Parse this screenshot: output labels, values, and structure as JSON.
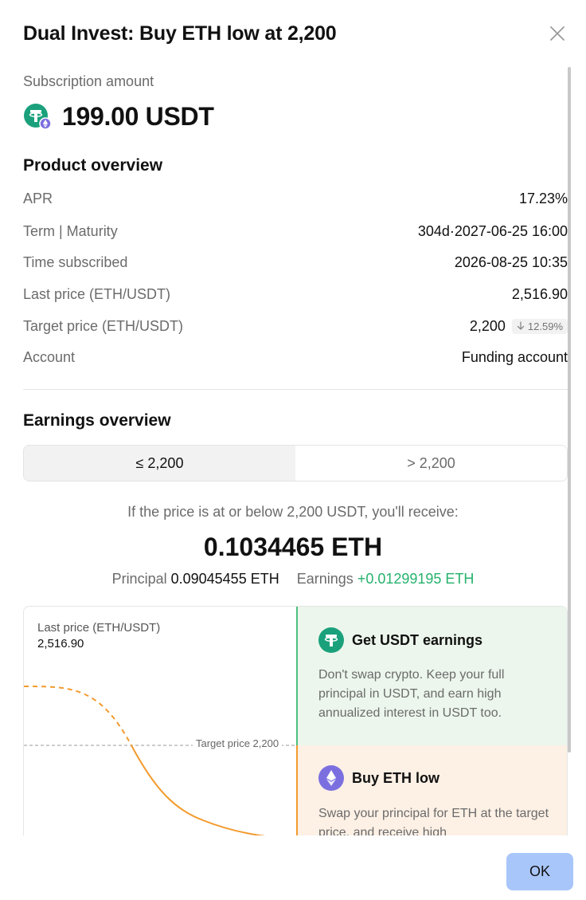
{
  "header": {
    "title": "Dual Invest: Buy ETH low at 2,200"
  },
  "subscription": {
    "label": "Subscription amount",
    "amount": "199.00 USDT",
    "coin_icon": "tether-icon"
  },
  "product_overview": {
    "title": "Product overview",
    "rows": [
      {
        "label": "APR",
        "value": "17.23%"
      },
      {
        "label": "Term | Maturity",
        "value": "304d·2027-06-25 16:00"
      },
      {
        "label": "Time subscribed",
        "value": "2026-08-25 10:35"
      },
      {
        "label": "Last price (ETH/USDT)",
        "value": "2,516.90"
      },
      {
        "label": "Target price (ETH/USDT)",
        "value": "2,200",
        "badge": "12.59%",
        "badge_icon": "arrow-down-icon"
      },
      {
        "label": "Account",
        "value": "Funding account"
      }
    ]
  },
  "earnings_overview": {
    "title": "Earnings overview",
    "tabs": [
      {
        "label": "≤ 2,200",
        "active": true
      },
      {
        "label": "> 2,200",
        "active": false
      }
    ],
    "receive_text": "If the price is at or below 2,200 USDT, you'll receive:",
    "receive_amount": "0.1034465 ETH",
    "principal_label": "Principal",
    "principal_value": "0.09045455 ETH",
    "earnings_label": "Earnings",
    "earnings_value": "+0.01299195 ETH"
  },
  "chart": {
    "last_price_label": "Last price (ETH/USDT)",
    "last_price_value": "2,516.90",
    "target_label": "Target price 2,200"
  },
  "outcomes": {
    "above": {
      "title": "Get USDT earnings",
      "body": "Don't swap crypto. Keep your full principal in USDT, and earn high annualized interest in USDT too.",
      "icon": "tether-icon"
    },
    "below": {
      "title": "Buy ETH low",
      "body": "Swap your principal for ETH at the target price, and receive high",
      "icon": "ethereum-icon"
    }
  },
  "footer": {
    "ok_label": "OK"
  },
  "colors": {
    "green": "#25b26d",
    "orange": "#f39b2e",
    "accent_button": "#a9c6fb",
    "tether": "#1aa17c",
    "eth": "#7b6fe0"
  }
}
